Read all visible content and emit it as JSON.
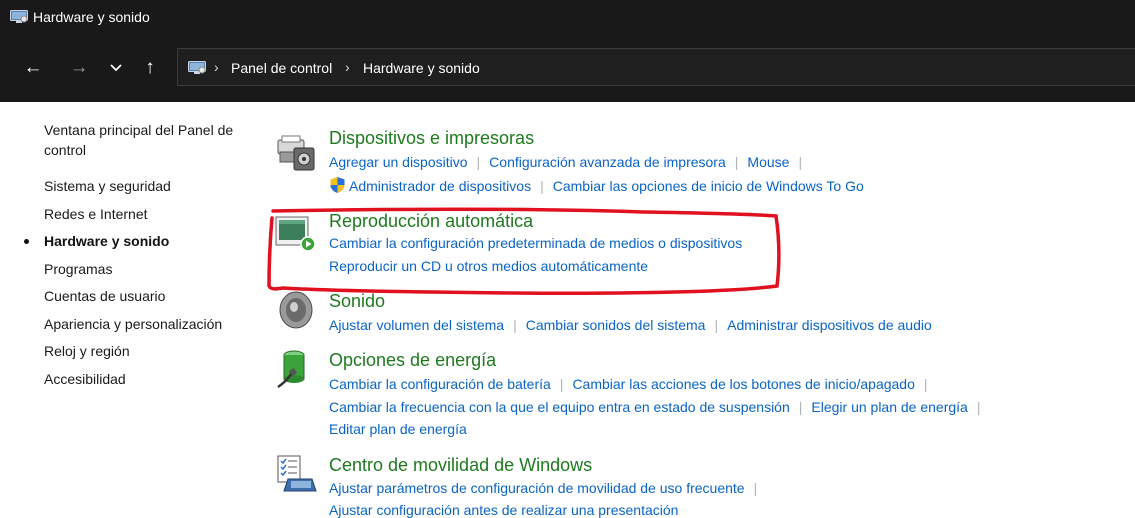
{
  "window": {
    "title": "Hardware y sonido"
  },
  "nav": {
    "back_icon": "arrow-left-icon",
    "forward_icon": "arrow-right-icon",
    "recent_icon": "chevron-down-icon",
    "up_icon": "arrow-up-icon",
    "breadcrumb": [
      "Panel de control",
      "Hardware y sonido"
    ]
  },
  "sidebar": {
    "home_line1": "Ventana principal del Panel de",
    "home_line2": "control",
    "items": [
      {
        "label": "Sistema y seguridad"
      },
      {
        "label": "Redes e Internet"
      },
      {
        "label": "Hardware y sonido",
        "active": true
      },
      {
        "label": "Programas"
      },
      {
        "label": "Cuentas de usuario"
      },
      {
        "label": "Apariencia y personalización"
      },
      {
        "label": "Reloj y región"
      },
      {
        "label": "Accesibilidad"
      }
    ]
  },
  "categories": {
    "devices": {
      "title": "Dispositivos e impresoras",
      "icon": "devices-printers-icon",
      "links": [
        "Agregar un dispositivo",
        "Configuración avanzada de impresora",
        "Mouse",
        "Administrador de dispositivos",
        "Cambiar las opciones de inicio de Windows To Go"
      ]
    },
    "autoplay": {
      "title": "Reproducción automática",
      "icon": "autoplay-icon",
      "links": [
        "Cambiar la configuración predeterminada de medios o dispositivos",
        "Reproducir un CD u otros medios automáticamente"
      ]
    },
    "sound": {
      "title": "Sonido",
      "icon": "speaker-icon",
      "links": [
        "Ajustar volumen del sistema",
        "Cambiar sonidos del sistema",
        "Administrar dispositivos de audio"
      ]
    },
    "power": {
      "title": "Opciones de energía",
      "icon": "battery-power-icon",
      "links": [
        "Cambiar la configuración de batería",
        "Cambiar las acciones de los botones de inicio/apagado",
        "Cambiar la frecuencia con la que el equipo entra en estado de suspensión",
        "Elegir un plan de energía",
        "Editar plan de energía"
      ]
    },
    "mobility": {
      "title": "Centro de movilidad de Windows",
      "icon": "mobility-center-icon",
      "links": [
        "Ajustar parámetros de configuración de movilidad de uso frecuente",
        "Ajustar configuración antes de realizar una presentación"
      ]
    }
  },
  "colors": {
    "titlebar": "#191919",
    "category_title": "#1e7a1e",
    "link": "#0a64c8",
    "annotation": "#e0101e"
  }
}
